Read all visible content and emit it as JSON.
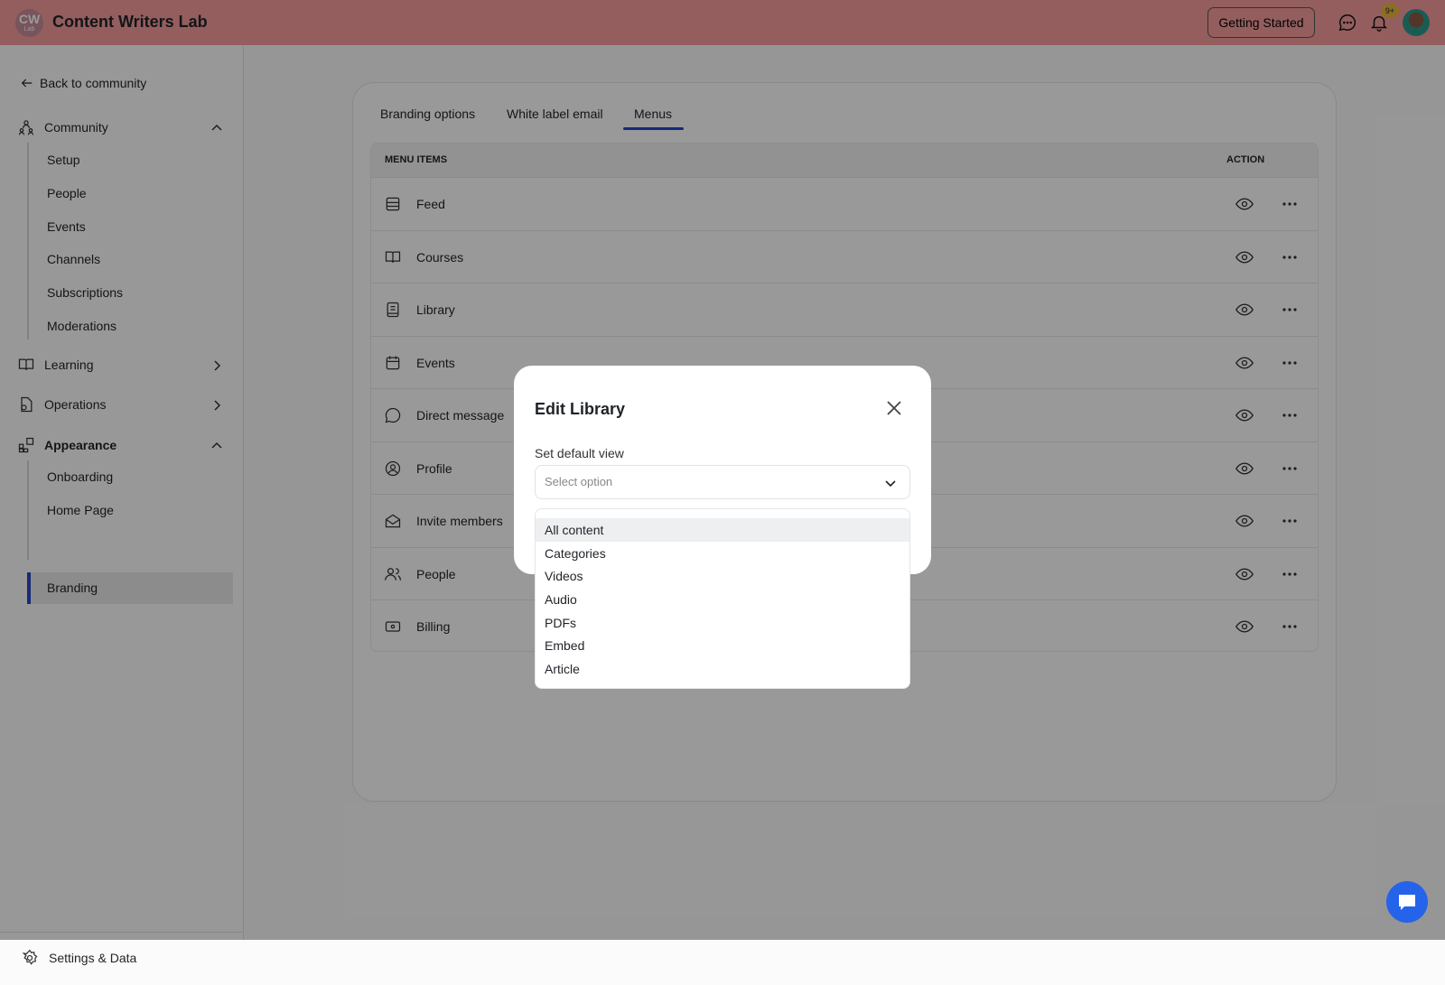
{
  "header": {
    "logo_text": "CW",
    "logo_sub": "Lab",
    "title": "Content Writers Lab",
    "getting_started": "Getting Started",
    "notification_badge": "9+",
    "brand_color": "#f79d9d"
  },
  "sidebar": {
    "back": "Back to community",
    "community": {
      "label": "Community",
      "items": [
        "Setup",
        "People",
        "Events",
        "Channels",
        "Subscriptions",
        "Moderations"
      ]
    },
    "learning": "Learning",
    "operations": "Operations",
    "appearance": {
      "label": "Appearance",
      "items": [
        "Onboarding",
        "Home Page",
        "Branding"
      ],
      "active": "Branding"
    },
    "settings": "Settings & Data"
  },
  "tabs": {
    "items": [
      "Branding options",
      "White label email",
      "Menus"
    ],
    "active": "Menus",
    "accent": "#2547c7"
  },
  "table": {
    "col_items": "MENU ITEMS",
    "col_action": "ACTION",
    "rows": [
      {
        "label": "Feed",
        "icon": "feed-icon"
      },
      {
        "label": "Courses",
        "icon": "book-open-icon"
      },
      {
        "label": "Library",
        "icon": "library-icon"
      },
      {
        "label": "Events",
        "icon": "calendar-icon"
      },
      {
        "label": "Direct message",
        "icon": "message-icon"
      },
      {
        "label": "Profile",
        "icon": "profile-icon"
      },
      {
        "label": "Invite members",
        "icon": "envelope-icon"
      },
      {
        "label": "People",
        "icon": "people-icon"
      },
      {
        "label": "Billing",
        "icon": "billing-icon"
      }
    ]
  },
  "modal": {
    "title": "Edit Library",
    "field_label": "Set default view",
    "placeholder": "Select option",
    "options": [
      "All content",
      "Categories",
      "Videos",
      "Audio",
      "PDFs",
      "Embed",
      "Article"
    ],
    "highlighted": "All content"
  }
}
